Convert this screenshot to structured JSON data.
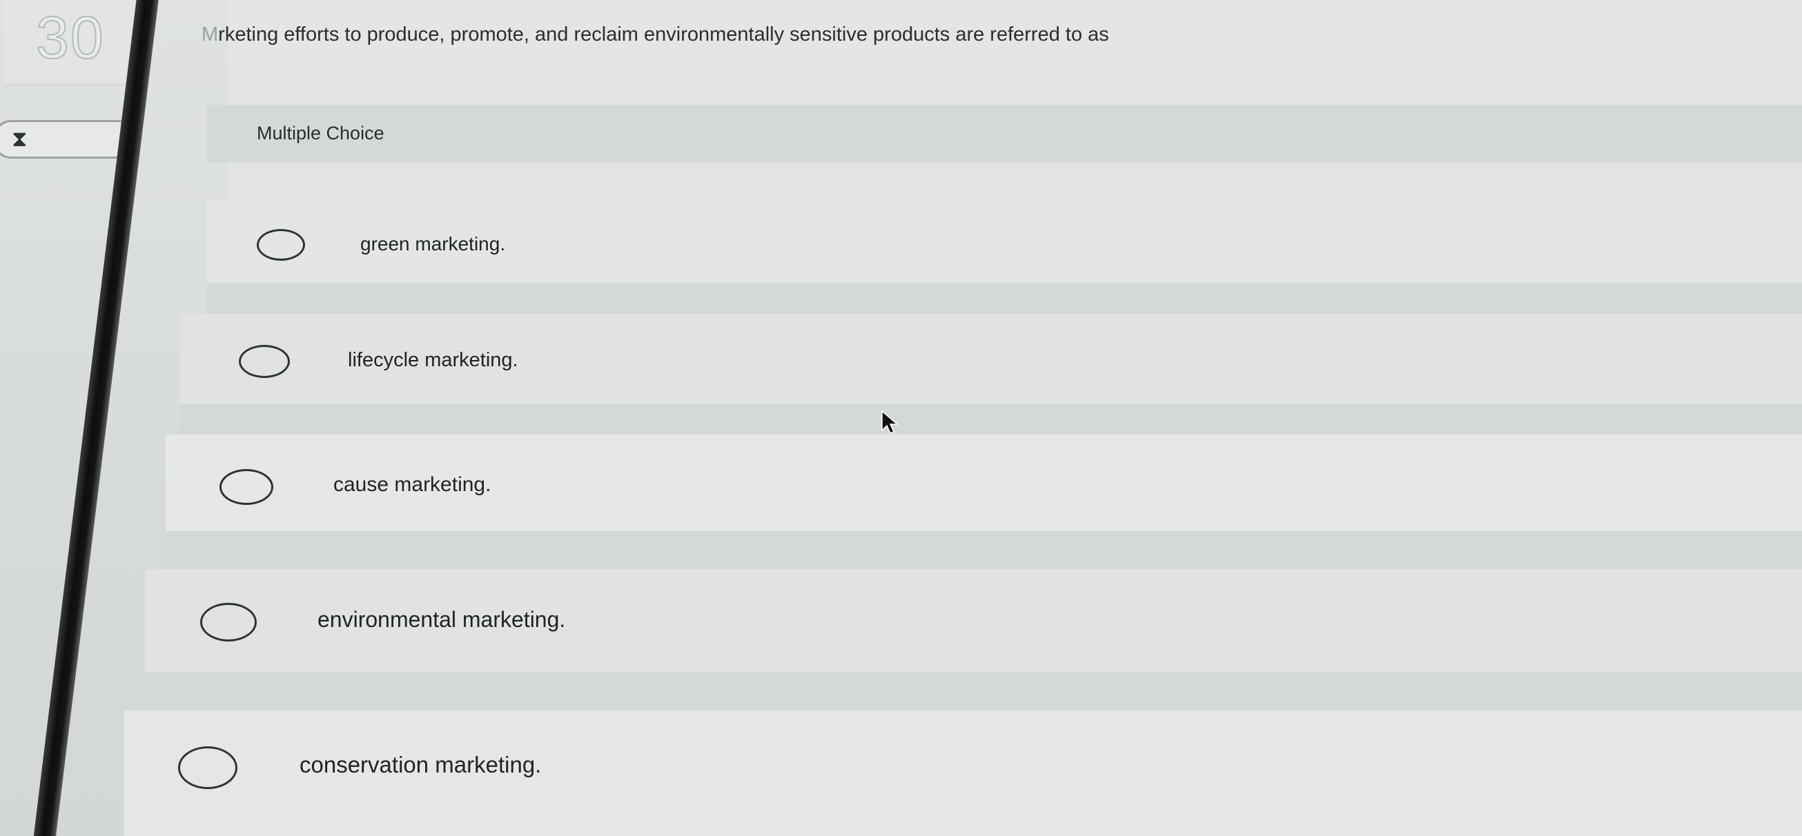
{
  "question": {
    "number": "30",
    "timer_text": "",
    "text": "rketing efforts to produce, promote, and reclaim environmentally sensitive products are referred to as"
  },
  "question_type": "Multiple Choice",
  "options": [
    {
      "label": "green marketing."
    },
    {
      "label": "lifecycle marketing."
    },
    {
      "label": "cause marketing."
    },
    {
      "label": "environmental marketing."
    },
    {
      "label": "conservation marketing."
    }
  ],
  "icons": {
    "timer": "hourglass-icon",
    "cursor": "mouse-pointer-icon"
  }
}
